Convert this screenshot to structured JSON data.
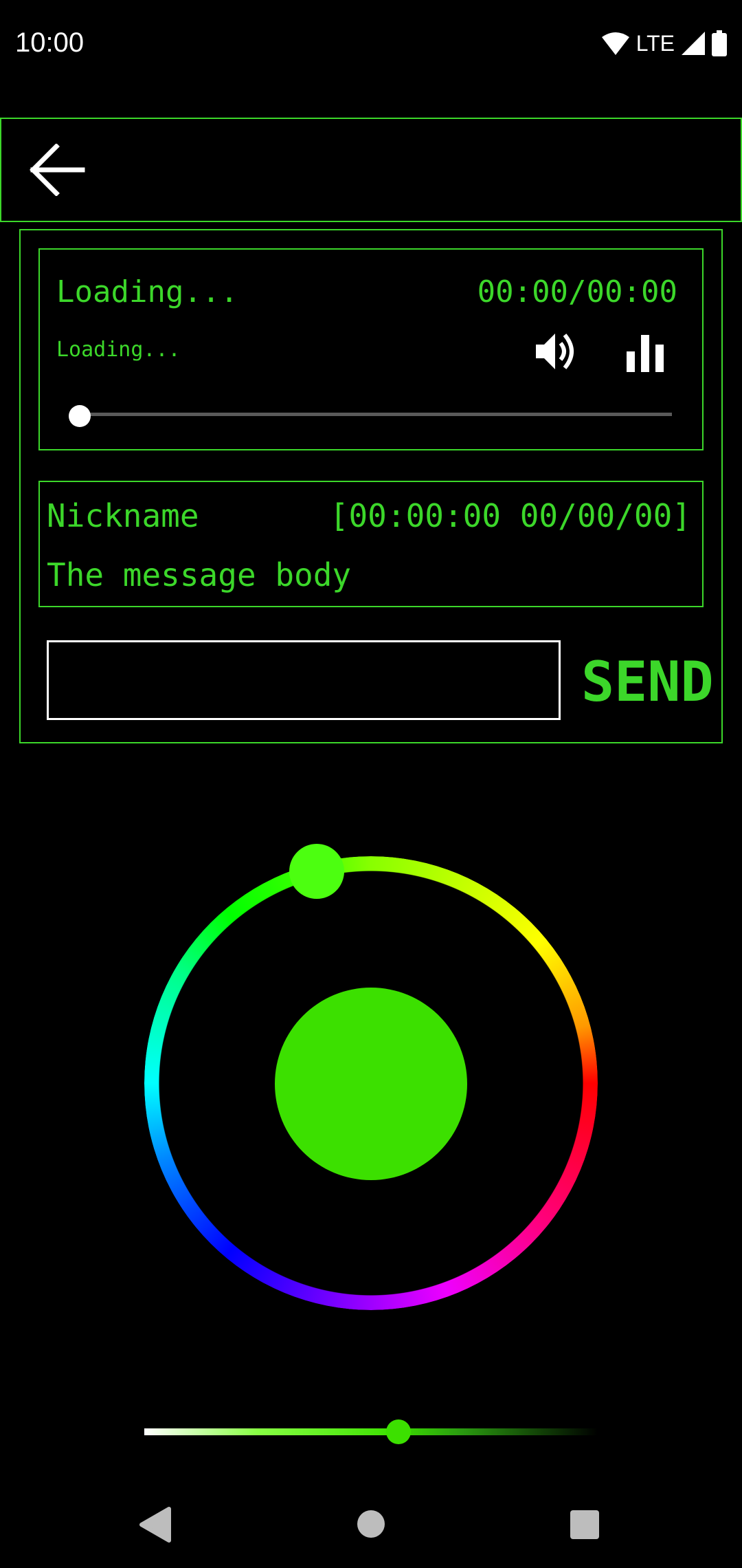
{
  "status_bar": {
    "time": "10:00",
    "network_label": "LTE",
    "icons": [
      "wifi-icon",
      "cell-signal-icon",
      "battery-icon"
    ]
  },
  "toolbar": {
    "back_icon": "arrow-back-icon"
  },
  "player": {
    "title": "Loading...",
    "time": "00:00/00:00",
    "subtitle": "Loading...",
    "volume_icon": "volume-up-icon",
    "equalizer_icon": "equalizer-icon",
    "progress": 0
  },
  "message": {
    "nickname": "Nickname",
    "timestamp": "[00:00:00 00/00/00]",
    "body": "The message body"
  },
  "composer": {
    "input_value": "",
    "send_label": "SEND"
  },
  "color_picker": {
    "selected_color": "#3ce000",
    "thumb_color": "#4cff10",
    "brightness_level": 0.56
  },
  "colors": {
    "accent": "#3cd72a",
    "background": "#000000"
  },
  "nav_bar": {
    "icons": [
      "nav-back-icon",
      "nav-home-icon",
      "nav-recents-icon"
    ]
  }
}
